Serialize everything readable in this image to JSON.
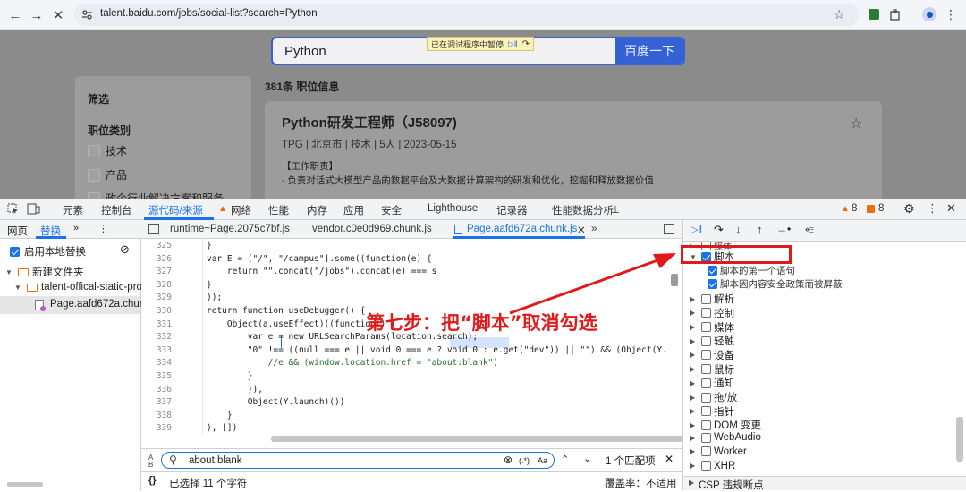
{
  "browser": {
    "url": "talent.baidu.com/jobs/social-list?search=Python",
    "icons": [
      "back-icon",
      "forward-icon",
      "stop-icon",
      "site-info-icon",
      "star-icon",
      "extension-icon",
      "puzzle-icon",
      "profile-icon",
      "menu-icon"
    ]
  },
  "page": {
    "search_value": "Python",
    "search_button": "百度一下",
    "paused_text": "已在调试程序中暂停",
    "filter_title": "筛选",
    "category_title": "职位类别",
    "categories": [
      "技术",
      "产品",
      "政企行业解决方案和服务"
    ],
    "result_count": "381条 职位信息",
    "job": {
      "title": "Python研发工程师（J58097)",
      "meta": "TPG | 北京市 | 技术 | 5人 | 2023-05-15",
      "section": "【工作职责】",
      "desc": "- 负责对话式大模型产品的数据平台及大数据计算架构的研发和优化，挖掘和释放数据价值"
    }
  },
  "devtools": {
    "tabs": [
      "元素",
      "控制台",
      "源代码/来源",
      "网络",
      "性能",
      "内存",
      "应用",
      "安全",
      "Lighthouse",
      "记录器",
      "性能数据分析"
    ],
    "warn_count": "8",
    "issue_count": "8",
    "left_tabs": [
      "网页",
      "替换"
    ],
    "enable_local_override": "启用本地替换",
    "tree": [
      "新建文件夹",
      "talent-offical-static-pro",
      "Page.aafd672a.chun"
    ],
    "file_tabs": [
      "runtime~Page.2075c7bf.js",
      "vendor.c0e0d969.chunk.js",
      "Page.aafd672a.chunk.js"
    ],
    "code_lines": [
      {
        "n": "325",
        "t": "            }"
      },
      {
        "n": "326",
        "t": "            var E = [\"/\", \"/campus\"].some((function(e) {"
      },
      {
        "n": "327",
        "t": "                return \"\".concat(\"/jobs\").concat(e) === s"
      },
      {
        "n": "328",
        "t": "            }"
      },
      {
        "n": "329",
        "t": "            ));"
      },
      {
        "n": "330",
        "t": "            return function useDebugger() {"
      },
      {
        "n": "331",
        "t": "                Object(a.useEffect)((function() {"
      },
      {
        "n": "332",
        "t": "                    var e = new URLSearchParams(location.search);"
      },
      {
        "n": "333",
        "t": "                    \"0\" !== ((null === e || void 0 === e ? void 0 : e.get(\"dev\")) || \"\") && (Object(Y."
      },
      {
        "n": "334",
        "t": "                        //e && (window.location.href = \"about:blank\")"
      },
      {
        "n": "335",
        "t": "                    }"
      },
      {
        "n": "336",
        "t": "                    )),"
      },
      {
        "n": "337",
        "t": "                    Object(Y.launch)())"
      },
      {
        "n": "338",
        "t": "                }"
      },
      {
        "n": "339",
        "t": "            ), [])"
      }
    ],
    "find_value": "about:blank",
    "match_count": "1 个匹配项",
    "regex_label": "(.*)",
    "case_label": "Aa",
    "status_selected": "已选择 11 个字符",
    "coverage": "覆盖率：不适用",
    "breakpoints": [
      {
        "label": "脚本",
        "checked": true,
        "expanded": true
      },
      {
        "label": "脚本的第一个语句",
        "checked": true,
        "child": true
      },
      {
        "label": "脚本因内容安全政策而被屏蔽",
        "checked": true,
        "child": true
      },
      {
        "label": "解析",
        "checked": false
      },
      {
        "label": "控制",
        "checked": false
      },
      {
        "label": "媒体",
        "checked": false
      },
      {
        "label": "轻触",
        "checked": false
      },
      {
        "label": "设备",
        "checked": false
      },
      {
        "label": "鼠标",
        "checked": false
      },
      {
        "label": "通知",
        "checked": false
      },
      {
        "label": "拖/放",
        "checked": false
      },
      {
        "label": "指针",
        "checked": false
      },
      {
        "label": "DOM 变更",
        "checked": false
      },
      {
        "label": "WebAudio",
        "checked": false
      },
      {
        "label": "Worker",
        "checked": false
      },
      {
        "label": "XHR",
        "checked": false
      }
    ],
    "csp_label": "CSP 违规断点",
    "cut_label": "媒体"
  },
  "annotation": "第七步：把“脚本”取消勾选",
  "colors": {
    "accent": "#3561d6",
    "annotation": "#e01a1a",
    "devtools_blue": "#1a73e8"
  }
}
